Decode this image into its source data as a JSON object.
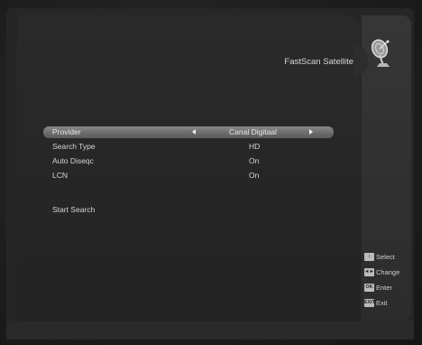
{
  "header": {
    "title": "FastScan Satellite"
  },
  "menu": {
    "rows": [
      {
        "label": "Provider",
        "value": "Canal Digitaal"
      },
      {
        "label": "Search Type",
        "value": "HD"
      },
      {
        "label": "Auto Diseqc",
        "value": "On"
      },
      {
        "label": "LCN",
        "value": "On"
      },
      {
        "label": "Start Search",
        "value": ""
      }
    ]
  },
  "legend": [
    {
      "key": "↕",
      "label": "Select"
    },
    {
      "key": "◄►",
      "label": "Change"
    },
    {
      "key": "OK",
      "label": "Enter"
    },
    {
      "key": "EXIT",
      "label": "Exit"
    }
  ]
}
